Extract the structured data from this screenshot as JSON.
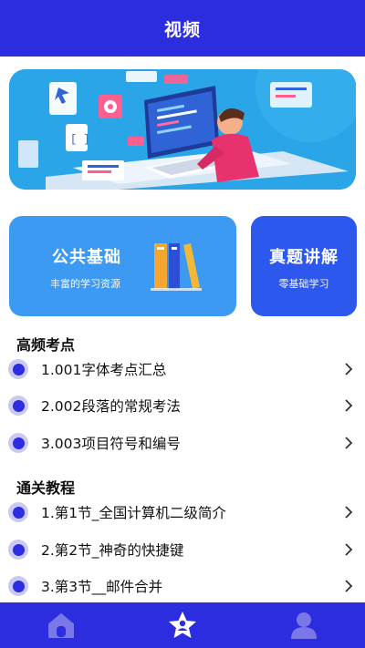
{
  "header": {
    "title": "视频"
  },
  "cards": {
    "public": {
      "title": "公共基础",
      "subtitle": "丰富的学习资源"
    },
    "exam": {
      "title": "真题讲解",
      "subtitle": "零基础学习"
    }
  },
  "sections": [
    {
      "title": "高频考点",
      "items": [
        {
          "label": "1.001字体考点汇总"
        },
        {
          "label": "2.002段落的常规考法"
        },
        {
          "label": "3.003项目符号和编号"
        }
      ]
    },
    {
      "title": "通关教程",
      "items": [
        {
          "label": "1.第1节_全国计算机二级简介"
        },
        {
          "label": "2.第2节_神奇的快捷键"
        },
        {
          "label": "3.第3节__邮件合并"
        }
      ]
    }
  ],
  "nav": [
    {
      "icon": "home-icon"
    },
    {
      "icon": "star-user-icon"
    },
    {
      "icon": "profile-icon"
    }
  ],
  "colors": {
    "primary": "#2d2de0",
    "card_public": "#3d9af3",
    "card_exam": "#2d58ee",
    "bullet_ring": "#c9c9f2"
  }
}
